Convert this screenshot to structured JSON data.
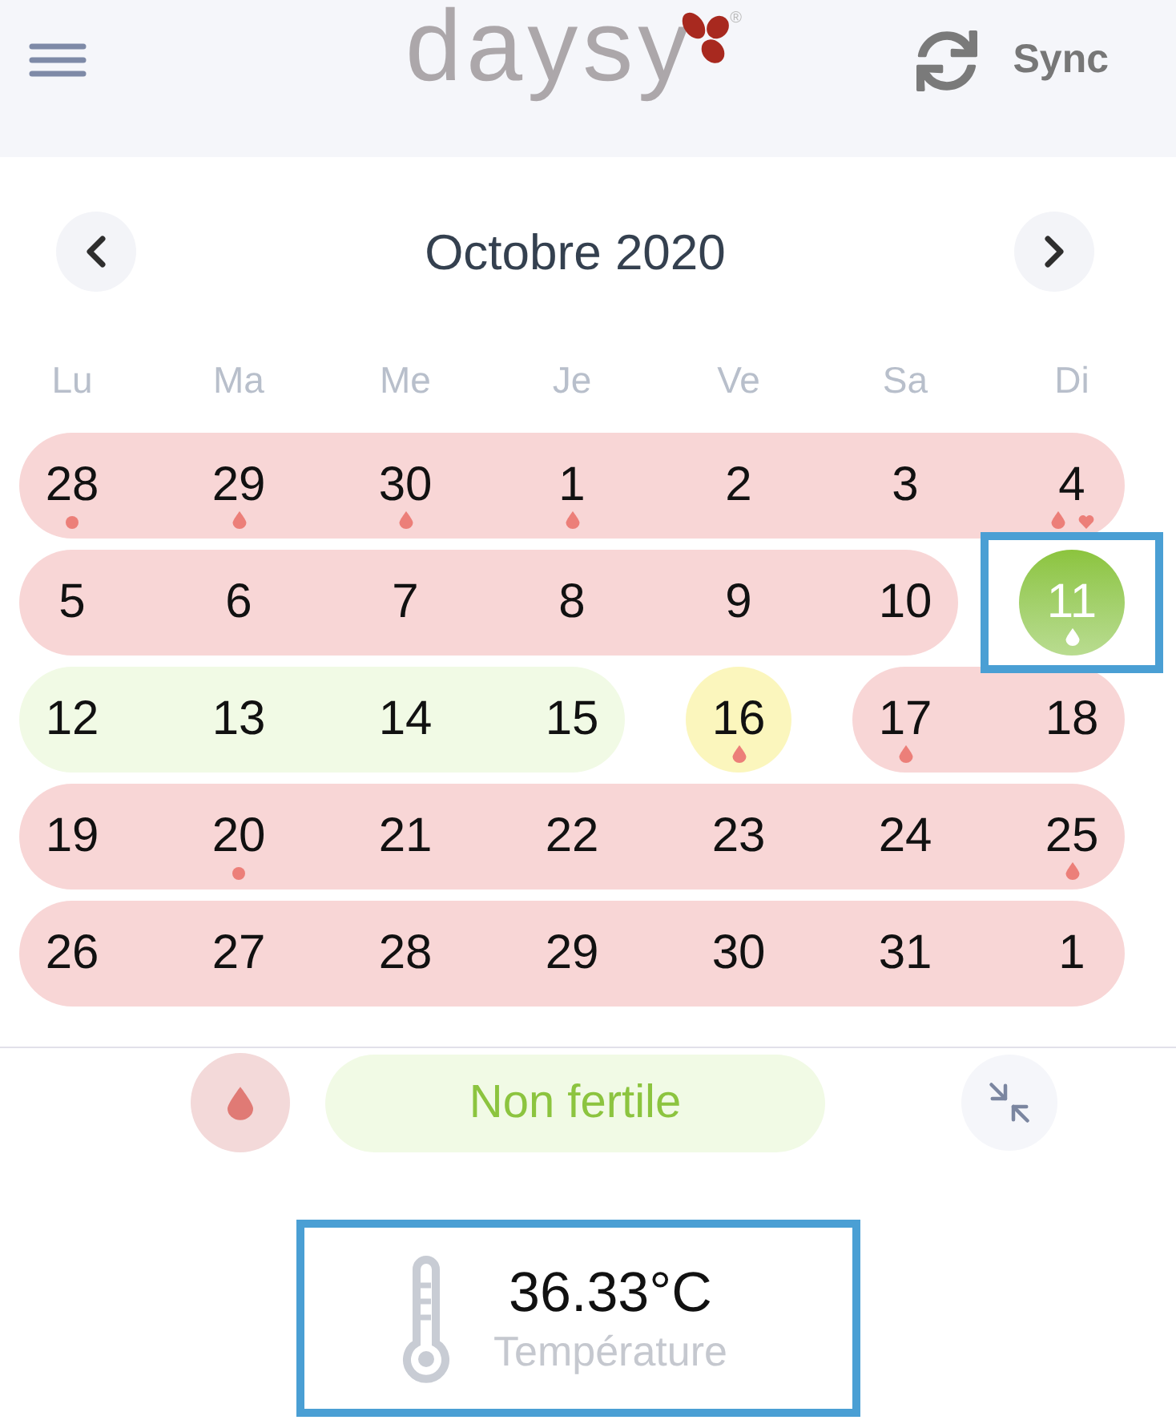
{
  "header": {
    "logo_text": "daysy",
    "logo_mark": "®",
    "sync_label": "Sync"
  },
  "month_nav": {
    "title": "Octobre 2020"
  },
  "calendar": {
    "weekdays": [
      "Lu",
      "Ma",
      "Me",
      "Je",
      "Ve",
      "Sa",
      "Di"
    ],
    "weeks": [
      {
        "days": [
          {
            "label": "28",
            "kind": "fertile",
            "selected": false,
            "highlighted": false,
            "marks": [
              {
                "kind": "dot"
              }
            ]
          },
          {
            "label": "29",
            "kind": "fertile",
            "selected": false,
            "highlighted": false,
            "marks": [
              {
                "kind": "drop"
              }
            ]
          },
          {
            "label": "30",
            "kind": "fertile",
            "selected": false,
            "highlighted": false,
            "marks": [
              {
                "kind": "drop"
              }
            ]
          },
          {
            "label": "1",
            "kind": "fertile",
            "selected": false,
            "highlighted": false,
            "marks": [
              {
                "kind": "drop"
              }
            ]
          },
          {
            "label": "2",
            "kind": "fertile",
            "selected": false,
            "highlighted": false
          },
          {
            "label": "3",
            "kind": "fertile",
            "selected": false,
            "highlighted": false
          },
          {
            "label": "4",
            "kind": "fertile",
            "selected": false,
            "highlighted": false,
            "marks": [
              {
                "kind": "drop"
              },
              {
                "kind": "heart"
              }
            ]
          }
        ]
      },
      {
        "days": [
          {
            "label": "5",
            "kind": "fertile",
            "selected": false,
            "highlighted": false
          },
          {
            "label": "6",
            "kind": "fertile",
            "selected": false,
            "highlighted": false
          },
          {
            "label": "7",
            "kind": "fertile",
            "selected": false,
            "highlighted": false
          },
          {
            "label": "8",
            "kind": "fertile",
            "selected": false,
            "highlighted": false
          },
          {
            "label": "9",
            "kind": "fertile",
            "selected": false,
            "highlighted": false
          },
          {
            "label": "10",
            "kind": "fertile",
            "selected": false,
            "highlighted": false
          },
          {
            "label": "11",
            "kind": "infertile",
            "selected": true,
            "highlighted": true,
            "marks": [
              {
                "kind": "drop"
              }
            ]
          }
        ]
      },
      {
        "days": [
          {
            "label": "12",
            "kind": "infertile",
            "selected": false,
            "highlighted": false
          },
          {
            "label": "13",
            "kind": "infertile",
            "selected": false,
            "highlighted": false
          },
          {
            "label": "14",
            "kind": "infertile",
            "selected": false,
            "highlighted": false
          },
          {
            "label": "15",
            "kind": "infertile",
            "selected": false,
            "highlighted": false
          },
          {
            "label": "16",
            "kind": "uncertain",
            "selected": false,
            "highlighted": false,
            "marks": [
              {
                "kind": "drop"
              }
            ]
          },
          {
            "label": "17",
            "kind": "fertile",
            "selected": false,
            "highlighted": false,
            "marks": [
              {
                "kind": "drop"
              }
            ]
          },
          {
            "label": "18",
            "kind": "fertile",
            "selected": false,
            "highlighted": false
          }
        ]
      },
      {
        "days": [
          {
            "label": "19",
            "kind": "fertile",
            "selected": false,
            "highlighted": false
          },
          {
            "label": "20",
            "kind": "fertile",
            "selected": false,
            "highlighted": false,
            "marks": [
              {
                "kind": "dot"
              }
            ]
          },
          {
            "label": "21",
            "kind": "fertile",
            "selected": false,
            "highlighted": false
          },
          {
            "label": "22",
            "kind": "fertile",
            "selected": false,
            "highlighted": false
          },
          {
            "label": "23",
            "kind": "fertile",
            "selected": false,
            "highlighted": false
          },
          {
            "label": "24",
            "kind": "fertile",
            "selected": false,
            "highlighted": false
          },
          {
            "label": "25",
            "kind": "fertile",
            "selected": false,
            "highlighted": false,
            "marks": [
              {
                "kind": "drop"
              }
            ]
          }
        ]
      },
      {
        "days": [
          {
            "label": "26",
            "kind": "fertile",
            "selected": false,
            "highlighted": false
          },
          {
            "label": "27",
            "kind": "fertile",
            "selected": false,
            "highlighted": false
          },
          {
            "label": "28",
            "kind": "fertile",
            "selected": false,
            "highlighted": false
          },
          {
            "label": "29",
            "kind": "fertile",
            "selected": false,
            "highlighted": false
          },
          {
            "label": "30",
            "kind": "fertile",
            "selected": false,
            "highlighted": false
          },
          {
            "label": "31",
            "kind": "fertile",
            "selected": false,
            "highlighted": false
          },
          {
            "label": "1",
            "kind": "fertile",
            "selected": false,
            "highlighted": false
          }
        ]
      }
    ]
  },
  "day_panel": {
    "status": {
      "kind": "infertile",
      "label": "Non fertile"
    },
    "temperature": {
      "value": "36.33°C",
      "label": "Température",
      "highlighted": true
    }
  }
}
